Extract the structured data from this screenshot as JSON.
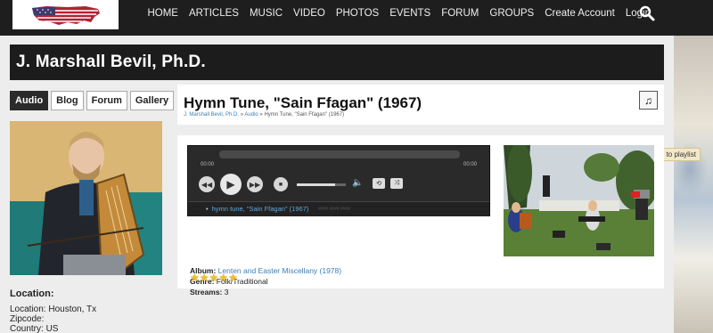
{
  "nav": {
    "items": [
      "HOME",
      "ARTICLES",
      "MUSIC",
      "VIDEO",
      "PHOTOS",
      "EVENTS",
      "FORUM",
      "GROUPS",
      "Create Account",
      "Login"
    ]
  },
  "profile": {
    "name": "J. Marshall Bevil, Ph.D.",
    "tabs": [
      "Audio",
      "Blog",
      "Forum",
      "Gallery"
    ],
    "active_tab": "Audio",
    "location_title": "Location:",
    "location": "Location: Houston, Tx",
    "zipcode": "Zipcode:",
    "country": "Country: US"
  },
  "track": {
    "title": "Hymn Tune, \"Sain Ffagan\" (1967)",
    "breadcrumb": [
      "J. Marshall Bevil, Ph.D.",
      "Audio",
      "Hymn Tune, \"Sain Ffagan\" (1967)"
    ],
    "playlist_icon": "music-note-icon",
    "tooltip": "add to playlist"
  },
  "player": {
    "time_elapsed": "00:00",
    "time_total": "00:00",
    "volume_level": 0.78,
    "playlist_item": "hymn tune, \"Sain Ffagan\" (1967)",
    "playlist_item_ghost": "#### #### ####"
  },
  "meta": {
    "album_label": "Album:",
    "album": "Lenten and Easter Miscellany (1978)",
    "genre_label": "Genre:",
    "genre": "Folk/Traditional",
    "streams_label": "Streams:",
    "streams": "3",
    "rating": 5
  },
  "colors": {
    "topbar": "#1e1e1e",
    "link": "#3a7fb8",
    "star": "#f1c21b"
  }
}
